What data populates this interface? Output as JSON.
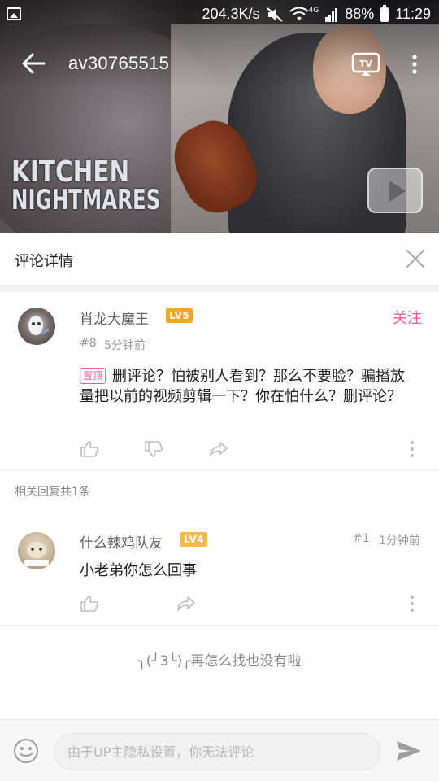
{
  "status_bar": {
    "speed": "204.3K/s",
    "network": "4G",
    "battery": "88%",
    "time": "11:29"
  },
  "video": {
    "title": "av30765515",
    "show_title_line1": "KITCHEN",
    "show_title_line2": "NIGHTMARES"
  },
  "panel": {
    "title": "评论详情"
  },
  "main_comment": {
    "username": "肖龙大魔王",
    "level": "LV5",
    "follow_label": "关注",
    "floor": "#8",
    "time": "5分钟前",
    "pinned_label": "置顶",
    "text": "删评论？怕被别人看到？那么不要脸？骗播放量把以前的视频剪辑一下？你在怕什么？删评论？"
  },
  "replies": {
    "count_label": "相关回复共1条",
    "items": [
      {
        "username": "什么辣鸡队友",
        "level": "LV4",
        "floor": "#1",
        "time": "1分钟前",
        "text": "小老弟你怎么回事"
      }
    ]
  },
  "end_message": "╮(╯3╰)╭再怎么找也没有啦",
  "input": {
    "placeholder": "由于UP主隐私设置，你无法评论"
  },
  "colors": {
    "accent_pink": "#f25d8e",
    "level_badge": "#f5a623",
    "lv4_badge": "#f7b84b"
  }
}
